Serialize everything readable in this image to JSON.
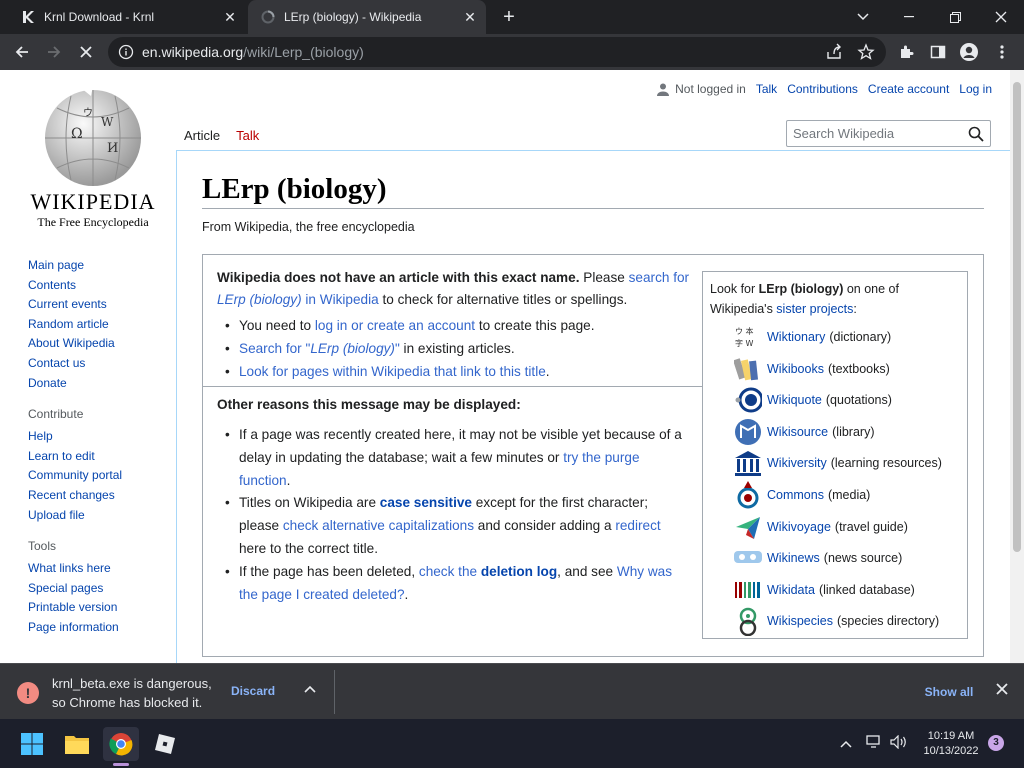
{
  "browser": {
    "tabs": [
      {
        "title": "Krnl Download - Krnl"
      },
      {
        "title": "LErp (biology) - Wikipedia"
      }
    ],
    "url_host": "en.wikipedia.org",
    "url_path": "/wiki/Lerp_(biology)"
  },
  "wiki": {
    "logo_wordmark": "WIKIPEDIA",
    "logo_tagline": "The Free Encyclopedia",
    "personal": {
      "not_logged_in": "Not logged in",
      "talk": "Talk",
      "contributions": "Contributions",
      "create_account": "Create account",
      "log_in": "Log in"
    },
    "search_placeholder": "Search Wikipedia",
    "page_tabs": {
      "article": "Article",
      "talk": "Talk"
    },
    "nav": {
      "main": [
        "Main page",
        "Contents",
        "Current events",
        "Random article",
        "About Wikipedia",
        "Contact us",
        "Donate"
      ],
      "contribute_heading": "Contribute",
      "contribute": [
        "Help",
        "Learn to edit",
        "Community portal",
        "Recent changes",
        "Upload file"
      ],
      "tools_heading": "Tools",
      "tools": [
        "What links here",
        "Special pages",
        "Printable version",
        "Page information"
      ]
    },
    "title": "LErp (biology)",
    "tagline": "From Wikipedia, the free encyclopedia",
    "notice": {
      "lead_bold": "Wikipedia does not have an article with this exact name.",
      "lead_please": " Please ",
      "lead_link": "search for LErp (biology) in Wikipedia",
      "lead_tail": " to check for alternative titles or spellings.",
      "b1_pre": "You need to ",
      "b1_link": "log in or create an account",
      "b1_post": " to create this page.",
      "b2_link": "Search for \"LErp (biology)\"",
      "b2_post": " in existing articles.",
      "b3_link": "Look for pages within Wikipedia that link to this title",
      "b3_post": ".",
      "other_heading": "Other reasons this message may be displayed:",
      "r1_pre": "If a page was recently created here, it may not be visible yet because of a delay in updating the database; wait a few minutes or ",
      "r1_link": "try the purge function",
      "r1_post": ".",
      "r2_pre": "Titles on Wikipedia are ",
      "r2_bold": "case sensitive",
      "r2_mid": " except for the first character; please ",
      "r2_link": "check alternative capitalizations",
      "r2_mid2": " and consider adding a ",
      "r2_link2": "redirect",
      "r2_post": " here to the correct title.",
      "r3_pre": "If the page has been deleted, ",
      "r3_link": "check the ",
      "r3_link_bold": "deletion log",
      "r3_mid": ", and see ",
      "r3_link2": "Why was the page I created deleted?",
      "r3_post": "."
    },
    "sister": {
      "intro_pre": "Look for ",
      "intro_bold": "LErp (biology)",
      "intro_mid": " on one of Wikipedia's ",
      "intro_link": "sister projects",
      "intro_post": ":",
      "projects": [
        {
          "name": "Wiktionary",
          "desc": "(dictionary)",
          "icon": "wiktionary-icon"
        },
        {
          "name": "Wikibooks",
          "desc": "(textbooks)",
          "icon": "wikibooks-icon"
        },
        {
          "name": "Wikiquote",
          "desc": "(quotations)",
          "icon": "wikiquote-icon"
        },
        {
          "name": "Wikisource",
          "desc": "(library)",
          "icon": "wikisource-icon"
        },
        {
          "name": "Wikiversity",
          "desc": "(learning resources)",
          "icon": "wikiversity-icon"
        },
        {
          "name": "Commons",
          "desc": "(media)",
          "icon": "commons-icon"
        },
        {
          "name": "Wikivoyage",
          "desc": "(travel guide)",
          "icon": "wikivoyage-icon"
        },
        {
          "name": "Wikinews",
          "desc": "(news source)",
          "icon": "wikinews-icon"
        },
        {
          "name": "Wikidata",
          "desc": "(linked database)",
          "icon": "wikidata-icon"
        },
        {
          "name": "Wikispecies",
          "desc": "(species directory)",
          "icon": "wikispecies-icon"
        }
      ]
    }
  },
  "download": {
    "message_line1": "krnl_beta.exe is dangerous,",
    "message_line2": "so Chrome has blocked it.",
    "discard": "Discard",
    "show_all": "Show all"
  },
  "taskbar": {
    "time": "10:19 AM",
    "date": "10/13/2022",
    "notification_count": "3"
  }
}
